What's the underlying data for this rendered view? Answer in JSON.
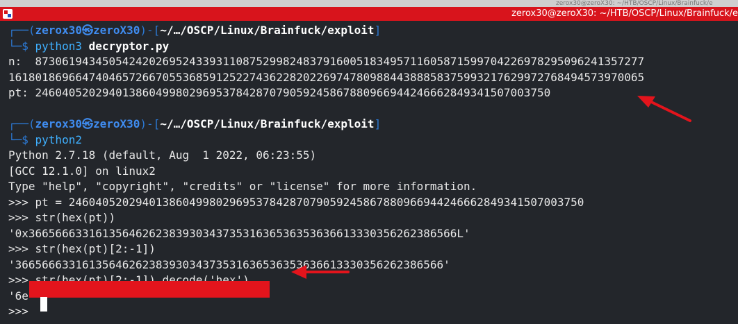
{
  "window": {
    "title": "zerox30@zeroX30: ~/HTB/OSCP/Linux/Brainfuck/e",
    "behind_title": "zerox30@zeroX30: ~/HTB/OSCP/Linux/Brainfuck/e"
  },
  "prompt1": {
    "frame_open": "┌──(",
    "user": "zerox30㉿zeroX30",
    "frame_mid": ")-[",
    "path": "~/…/OSCP/Linux/Brainfuck/exploit",
    "frame_close": "]",
    "frame_prompt": "└─$ ",
    "command": "python3",
    "argument": " decryptor.py"
  },
  "output1": [
    "n:  8730619434505424202695243393110875299824837916005183495711605871599704226978295096241357277",
    "16180186966474046572667055368591252274362282022697478098844388858375993217629972768494573970065",
    "pt: 24604052029401386049980296953784287079059245867880966944246662849341507003750"
  ],
  "prompt2": {
    "frame_open": "┌──(",
    "user": "zerox30㉿zeroX30",
    "frame_mid": ")-[",
    "path": "~/…/OSCP/Linux/Brainfuck/exploit",
    "frame_close": "]",
    "frame_prompt": "└─$ ",
    "command": "python2"
  },
  "python_session": [
    "Python 2.7.18 (default, Aug  1 2022, 06:23:55)",
    "[GCC 12.1.0] on linux2",
    "Type \"help\", \"copyright\", \"credits\" or \"license\" for more information.",
    ">>> pt = 24604052029401386049980296953784287079059245867880966944246662849341507003750",
    ">>> str(hex(pt))",
    "'0x3665666331613564626238393034373531636536353636613330356262386566L'",
    ">>> str(hex(pt)[2:-1])",
    "'3665666331613564626238393034373531636536353636613330356262386566'",
    ">>> str(hex(pt)[2:-1]).decode('hex')",
    "'6e",
    ">>> "
  ],
  "colors": {
    "terminal_bg": "#23262b",
    "titlebar": "#d8141c",
    "redaction": "#e3141c",
    "arrow": "#e3141c",
    "prompt_frame": "#2c7ad6",
    "prompt_user": "#3f8cf0"
  },
  "icons": {
    "window_icon": "terminal-window-icon",
    "annotation": "red-arrow-icon"
  }
}
